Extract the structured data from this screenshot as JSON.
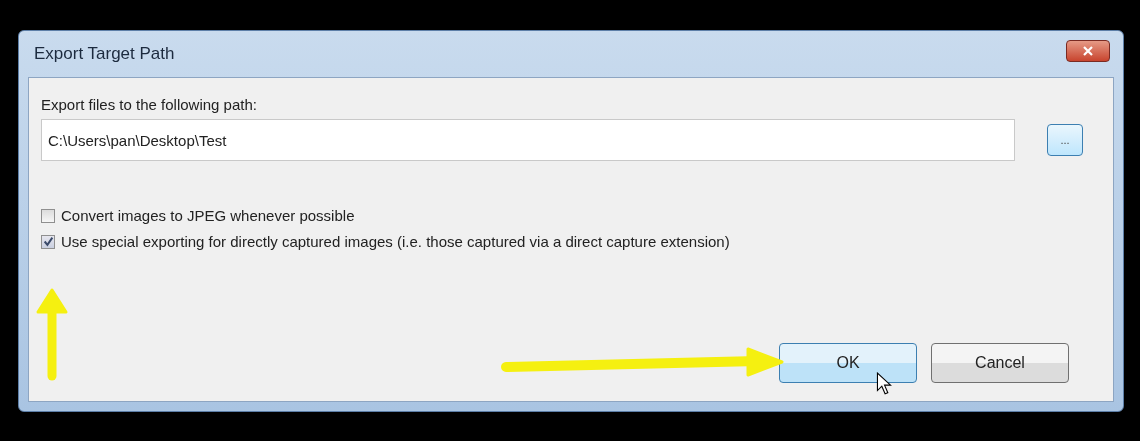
{
  "window": {
    "title": "Export Target Path"
  },
  "path": {
    "label": "Export files to the following path:",
    "value": "C:\\Users\\pan\\Desktop\\Test",
    "browse": "..."
  },
  "options": [
    {
      "label": "Convert images to JPEG whenever possible",
      "checked": false
    },
    {
      "label": "Use special exporting for directly captured images (i.e. those captured via a direct capture extension)",
      "checked": true
    }
  ],
  "buttons": [
    {
      "label": "OK",
      "default": true
    },
    {
      "label": "Cancel",
      "default": false
    }
  ]
}
